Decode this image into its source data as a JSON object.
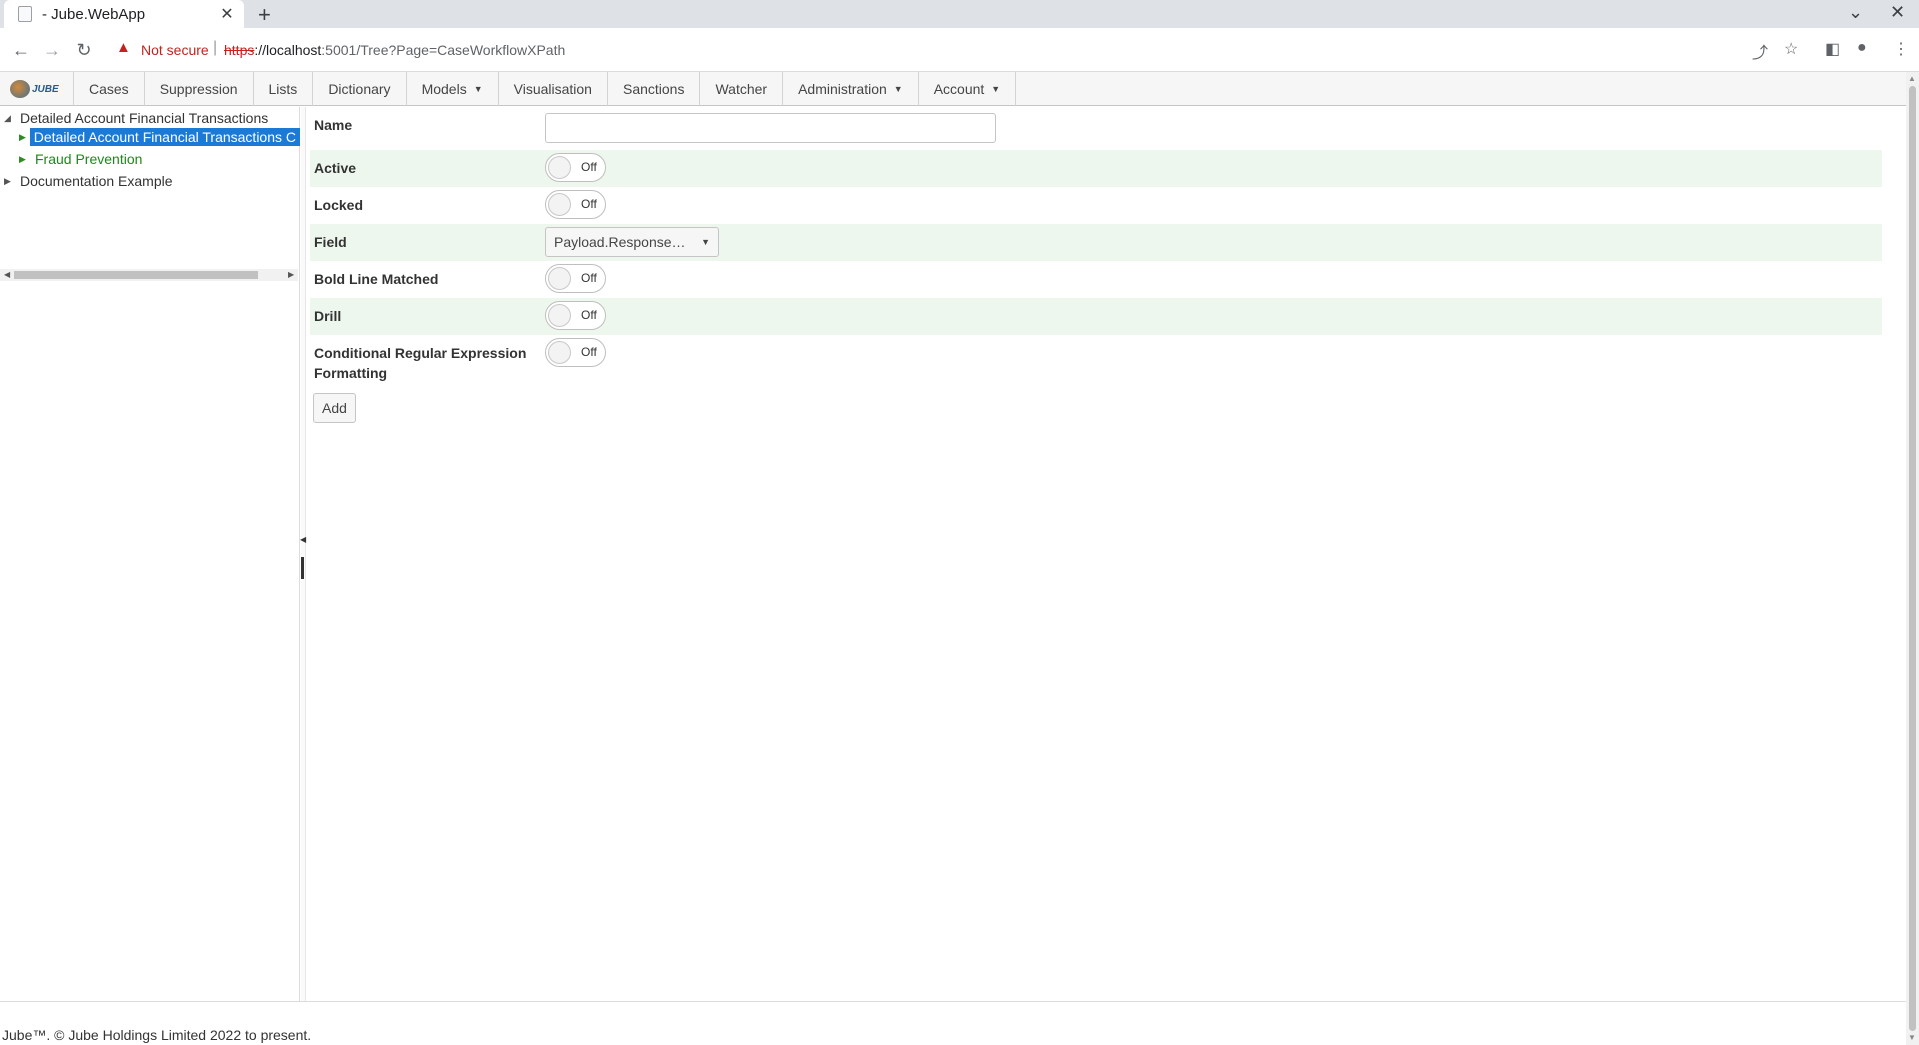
{
  "browser": {
    "tab_title": "- Jube.WebApp",
    "new_tab_symbol": "+",
    "not_secure_label": "Not secure",
    "url_scheme": "https",
    "url_host": "://localhost",
    "url_path": ":5001/Tree?Page=CaseWorkflowXPath"
  },
  "menu": {
    "logo_text": "JUBE",
    "items": [
      "Cases",
      "Suppression",
      "Lists",
      "Dictionary",
      "Models",
      "Visualisation",
      "Sanctions",
      "Watcher",
      "Administration",
      "Account"
    ]
  },
  "tree": {
    "root": "Detailed Account Financial Transactions",
    "child_selected": "Detailed Account Financial Transactions C",
    "child_2": "Fraud Prevention",
    "root_2": "Documentation Example"
  },
  "form": {
    "name_label": "Name",
    "name_value": "",
    "active_label": "Active",
    "locked_label": "Locked",
    "field_label": "Field",
    "field_value": "Payload.Response…",
    "bold_label": "Bold Line Matched",
    "drill_label": "Drill",
    "conditional_label": "Conditional Regular Expression Formatting",
    "toggle_off": "Off",
    "add_button": "Add"
  },
  "footer": {
    "text": "Jube™. © Jube Holdings Limited 2022 to present."
  },
  "colors": {
    "selected_node": "#1b7ad6",
    "tree_green": "#1a8a1a",
    "row_shade": "#eef7ee",
    "warning_red": "#c5221f"
  }
}
